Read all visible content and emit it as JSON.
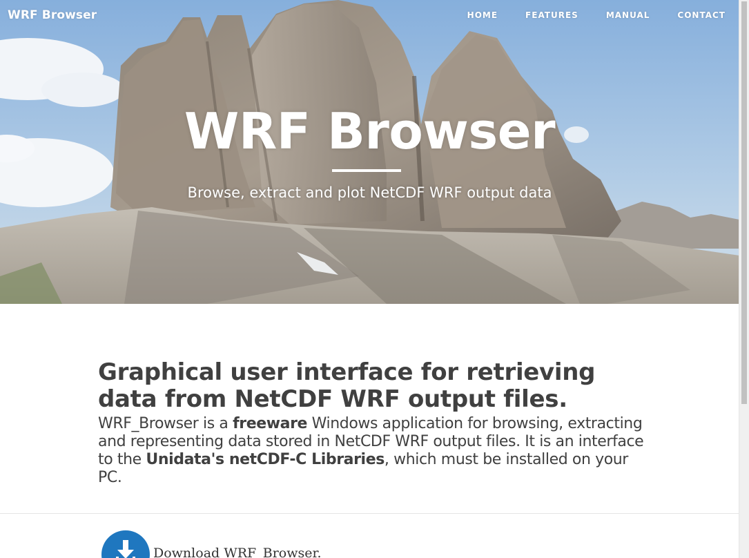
{
  "navbar": {
    "brand": "WRF Browser",
    "links": [
      {
        "label": "HOME"
      },
      {
        "label": "FEATURES"
      },
      {
        "label": "MANUAL"
      },
      {
        "label": "CONTACT"
      }
    ]
  },
  "hero": {
    "title": "WRF Browser",
    "subtitle": "Browse, extract and plot NetCDF WRF output data"
  },
  "intro": {
    "heading": "Graphical user interface for retrieving data from NetCDF WRF output files.",
    "text_1": "WRF_Browser is a ",
    "bold_1": "freeware",
    "text_2": " Windows application for browsing, extracting and representing data stored in NetCDF WRF output files. It is an interface to the ",
    "bold_2": "Unidata's netCDF-C Libraries",
    "text_3": ", which must be installed on your PC."
  },
  "download": {
    "label": "Download WRF_Browser.",
    "icon": "download-arrow-icon"
  },
  "colors": {
    "accent": "#1f77bf",
    "text": "#404040",
    "hero_text": "#ffffff"
  }
}
